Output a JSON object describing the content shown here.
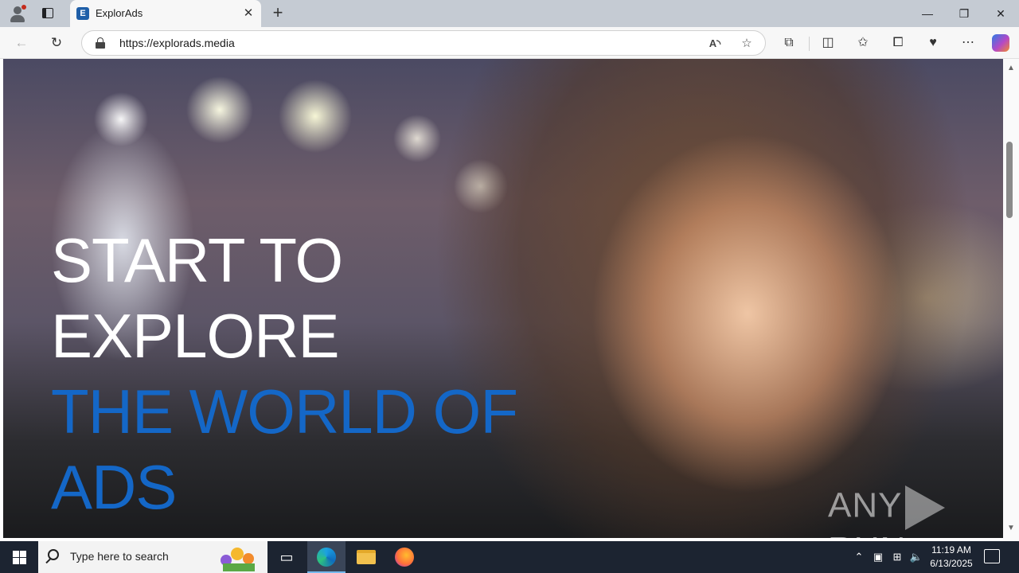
{
  "browser": {
    "tab": {
      "favicon_letter": "E",
      "title": "ExplorAds",
      "close_glyph": "✕"
    },
    "new_tab_glyph": "+",
    "window_controls": {
      "minimize": "—",
      "restore": "❐",
      "close": "✕"
    },
    "address": {
      "url": "https://explorads.media"
    },
    "nav": {
      "back": "←",
      "refresh": "↻"
    },
    "toolbar_icons": [
      "read-aloud-icon",
      "favorite-add-icon",
      "extensions-icon",
      "split-screen-icon",
      "favorites-icon",
      "collections-icon",
      "browser-essentials-icon",
      "more-icon",
      "copilot-icon"
    ]
  },
  "page": {
    "headline": {
      "line1": "START TO",
      "line2": "EXPLORE",
      "line3": "THE WORLD OF",
      "line4": "ADS"
    },
    "watermark": {
      "left": "ANY",
      "right": "RUN"
    },
    "colors": {
      "headline_white": "#ffffff",
      "headline_blue": "#1467c7"
    }
  },
  "taskbar": {
    "search_placeholder": "Type here to search",
    "time": "11:19 AM",
    "date": "6/13/2025",
    "pinned": [
      "task-view-icon",
      "edge-icon",
      "file-explorer-icon",
      "firefox-icon"
    ]
  }
}
